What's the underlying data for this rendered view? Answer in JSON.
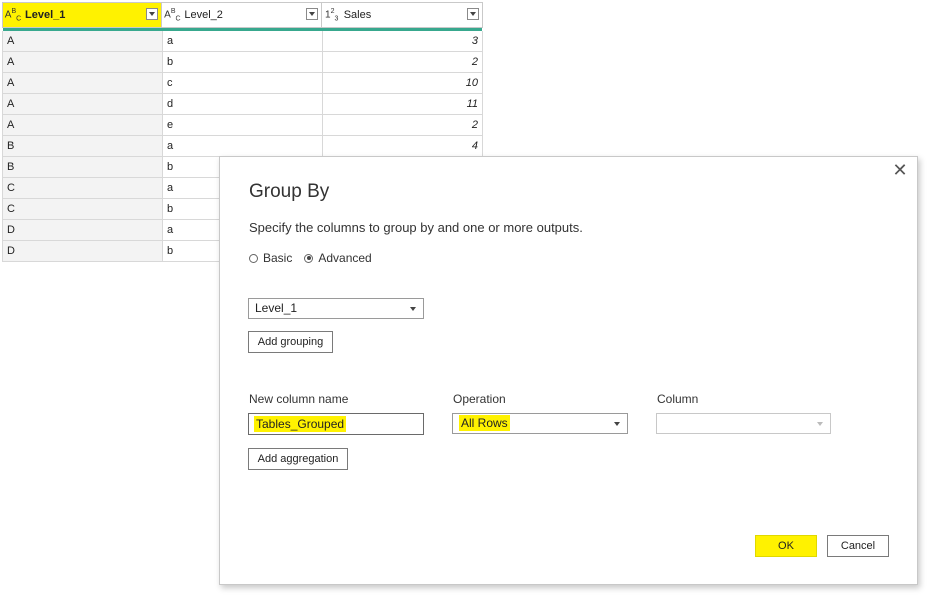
{
  "grid": {
    "columns": [
      {
        "type_icon": "ABC",
        "name": "Level_1"
      },
      {
        "type_icon": "ABC",
        "name": "Level_2"
      },
      {
        "type_icon": "123",
        "name": "Sales"
      }
    ],
    "rows": [
      [
        "A",
        "a",
        "3"
      ],
      [
        "A",
        "b",
        "2"
      ],
      [
        "A",
        "c",
        "10"
      ],
      [
        "A",
        "d",
        "11"
      ],
      [
        "A",
        "e",
        "2"
      ],
      [
        "B",
        "a",
        "4"
      ],
      [
        "B",
        "b",
        ""
      ],
      [
        "C",
        "a",
        ""
      ],
      [
        "C",
        "b",
        ""
      ],
      [
        "D",
        "a",
        ""
      ],
      [
        "D",
        "b",
        ""
      ]
    ]
  },
  "dialog": {
    "title": "Group By",
    "description": "Specify the columns to group by and one or more outputs.",
    "mode_options": {
      "basic": "Basic",
      "advanced": "Advanced",
      "selected": "Advanced"
    },
    "grouping_value": "Level_1",
    "add_grouping_label": "Add grouping",
    "new_column_label": "New column name",
    "operation_label": "Operation",
    "column_label": "Column",
    "new_column_value": "Tables_Grouped",
    "operation_value": "All Rows",
    "column_value": "",
    "add_aggregation_label": "Add aggregation",
    "ok_label": "OK",
    "cancel_label": "Cancel",
    "close_icon": "close-icon",
    "highlight_color": "#fff200"
  }
}
